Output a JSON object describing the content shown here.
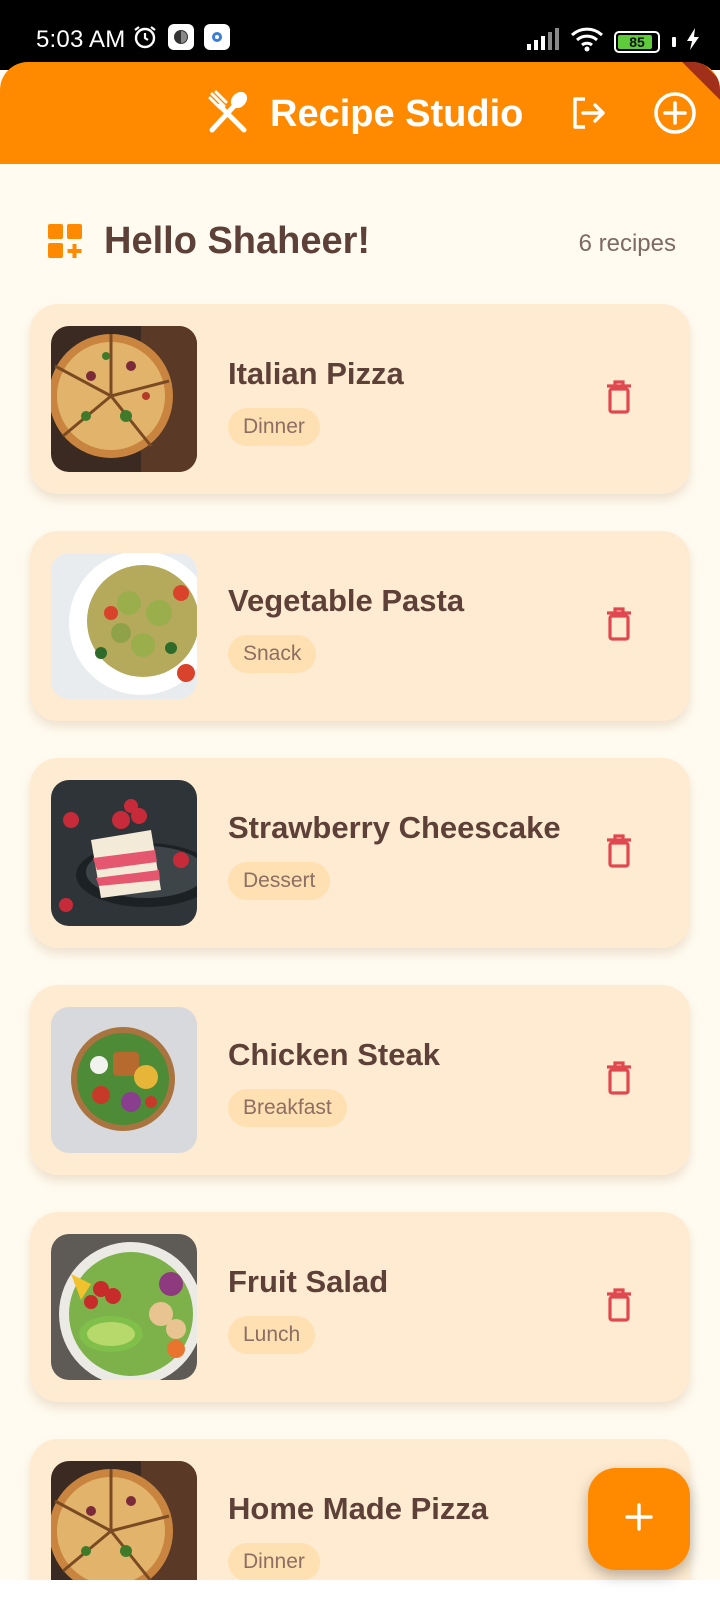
{
  "status_bar": {
    "time": "5:03 AM",
    "battery": "85",
    "icons": [
      "alarm-icon",
      "focus-icon",
      "settings-icon",
      "signal-icon",
      "wifi-icon",
      "battery-icon",
      "charging-icon"
    ]
  },
  "app_bar": {
    "title": "Recipe Studio",
    "logo_icon": "fork-spoon-icon",
    "actions": [
      "logout-icon",
      "add-circle-icon"
    ],
    "color": "#FF8A00"
  },
  "header": {
    "greeting": "Hello Shaheer!",
    "count": "6 recipes",
    "icon": "dashboard-add-icon"
  },
  "recipes": [
    {
      "name": "Italian Pizza",
      "category": "Dinner",
      "image": "pizza"
    },
    {
      "name": "Vegetable Pasta",
      "category": "Snack",
      "image": "pasta"
    },
    {
      "name": "Strawberry Cheescake",
      "category": "Dessert",
      "image": "cheesecake"
    },
    {
      "name": "Chicken Steak",
      "category": "Breakfast",
      "image": "salad-bowl"
    },
    {
      "name": "Fruit Salad",
      "category": "Lunch",
      "image": "salad-plate"
    },
    {
      "name": "Home Made Pizza",
      "category": "Dinner",
      "image": "pizza"
    }
  ],
  "colors": {
    "accent": "#FF8A00",
    "card": "#FFEBD1",
    "tag": "#FFE0B2",
    "text": "#5D4037",
    "delete": "#E0484F",
    "background": "#FFFBF0"
  },
  "fab": {
    "icon": "plus-icon"
  }
}
